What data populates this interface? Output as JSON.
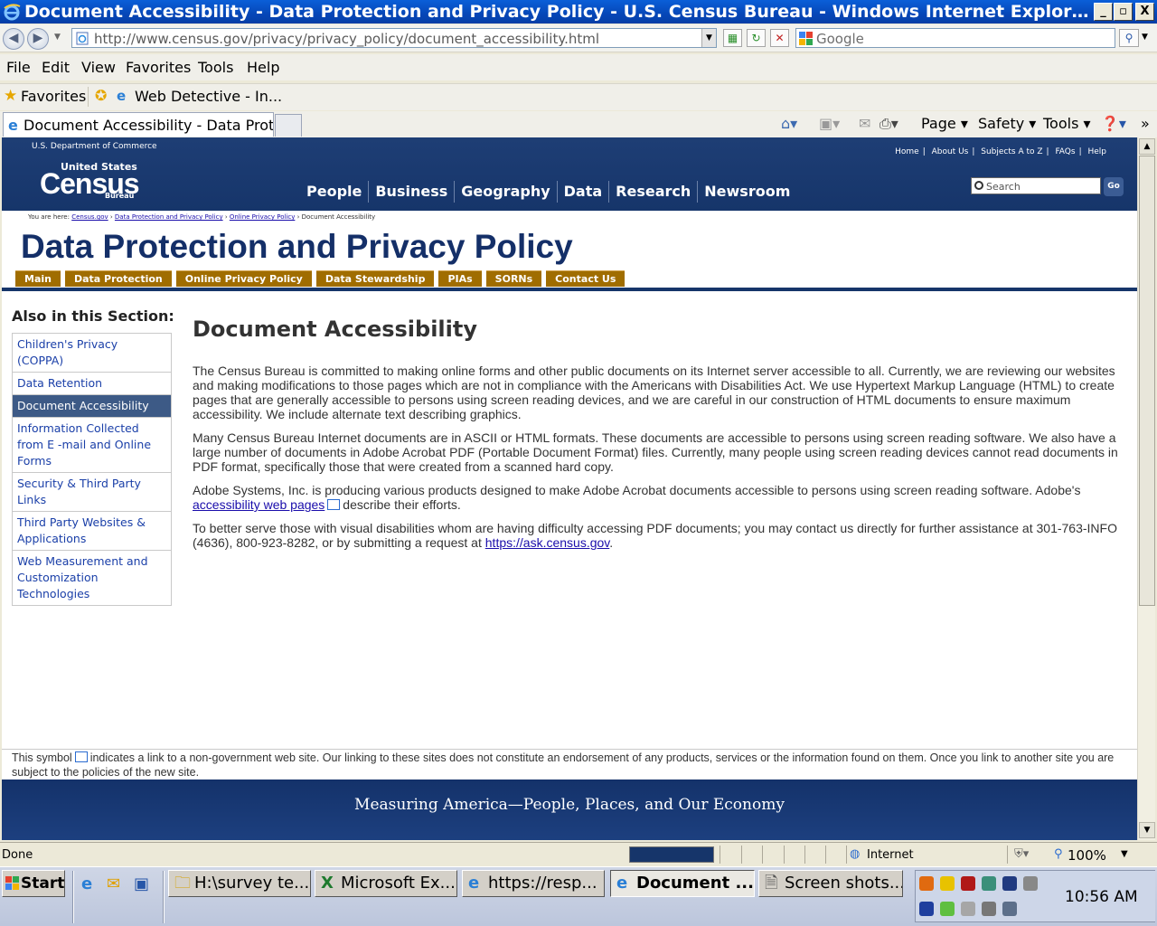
{
  "window": {
    "title": "Document Accessibility - Data Protection and Privacy Policy - U.S. Census Bureau - Windows Internet Explorer provided b...",
    "min_label": "_",
    "max_label": "▫",
    "close_label": "X"
  },
  "address_bar": {
    "url": "http://www.census.gov/privacy/privacy_policy/document_accessibility.html",
    "search_placeholder": "Google"
  },
  "menu": [
    "File",
    "Edit",
    "View",
    "Favorites",
    "Tools",
    "Help"
  ],
  "favorites_bar": {
    "favorites_label": "Favorites",
    "item": "Web Detective - In..."
  },
  "tabs": {
    "active_tab": "Document Accessibility - Data Prote..."
  },
  "command_bar": {
    "page": "Page",
    "safety": "Safety",
    "tools": "Tools"
  },
  "site_header": {
    "department": "U.S. Department of Commerce",
    "logo_top": "United States",
    "logo_main": "Census",
    "logo_bottom": "Bureau",
    "top_links": [
      "Home",
      "About Us",
      "Subjects A to Z",
      "FAQs",
      "Help"
    ],
    "nav": [
      "People",
      "Business",
      "Geography",
      "Data",
      "Research",
      "Newsroom"
    ],
    "search_placeholder": "Search",
    "go_label": "Go"
  },
  "breadcrumb": {
    "prefix": "You are here:",
    "links": [
      "Census.gov",
      "Data Protection and Privacy Policy",
      "Online Privacy Policy"
    ],
    "current": "Document Accessibility"
  },
  "page_title": "Data Protection and Privacy Policy",
  "sub_tabs": [
    "Main",
    "Data Protection",
    "Online Privacy Policy",
    "Data Stewardship",
    "PIAs",
    "SORNs",
    "Contact Us"
  ],
  "sidebar": {
    "heading": "Also in this Section:",
    "items": [
      {
        "label": "Children's Privacy (COPPA)",
        "active": false
      },
      {
        "label": "Data Retention",
        "active": false
      },
      {
        "label": "Document Accessibility",
        "active": true
      },
      {
        "label": "Information Collected from E -mail and Online Forms",
        "active": false
      },
      {
        "label": "Security & Third Party Links",
        "active": false
      },
      {
        "label": "Third Party Websites & Applications",
        "active": false
      },
      {
        "label": "Web Measurement and Customization Technologies",
        "active": false
      }
    ]
  },
  "main": {
    "heading": "Document Accessibility",
    "p1": "The Census Bureau is committed to making online forms and other public documents on its Internet server accessible to all. Currently, we are reviewing our websites and making modifications to those pages which are not in compliance with the Americans with Disabilities Act. We use Hypertext Markup Language (HTML) to create pages that are generally accessible to persons using screen reading devices, and we are careful in our construction of HTML documents to ensure maximum accessibility. We include alternate text describing graphics.",
    "p2": "Many Census Bureau Internet documents are in ASCII or HTML formats. These documents are accessible to persons using screen reading software. We also have a large number of documents in Adobe Acrobat PDF (Portable Document Format) files. Currently, many people using screen reading devices cannot read documents in PDF format, specifically those that were created from a scanned hard copy.",
    "p3_before": "Adobe Systems, Inc. is producing various products designed to make Adobe Acrobat documents accessible to persons using screen reading software. Adobe's",
    "p3_link": "accessibility web pages",
    "p3_after": "describe their efforts.",
    "p4_before": "To better serve those with visual disabilities whom are having difficulty accessing PDF documents; you may contact us directly for further assistance at 301-763-INFO (4636), 800-923-8282, or by submitting a request at",
    "p4_link": "https://ask.census.gov",
    "p4_after": "."
  },
  "footnote": {
    "before": "This symbol",
    "after": "indicates a link to a non-government web site. Our linking to these sites does not constitute an endorsement of any products, services or the information found on them. Once you link to another site you are subject to the policies of the new site."
  },
  "footer_tagline": "Measuring America—People, Places, and Our Economy",
  "status_bar": {
    "status": "Done",
    "zone": "Internet",
    "zoom": "100%"
  },
  "taskbar": {
    "start": "Start",
    "buttons": [
      {
        "label": "H:\\survey te...",
        "pressed": false
      },
      {
        "label": "Microsoft Ex...",
        "pressed": false
      },
      {
        "label": "https://resp...",
        "pressed": false
      },
      {
        "label": "Document ...",
        "pressed": true
      },
      {
        "label": "Screen shots...",
        "pressed": false
      }
    ],
    "clock": "10:56 AM"
  },
  "colors": {
    "census_blue": "#16356a",
    "tab_gold": "#a06d00",
    "link": "#1a0dab",
    "sidebar_active": "#3d5a86"
  }
}
